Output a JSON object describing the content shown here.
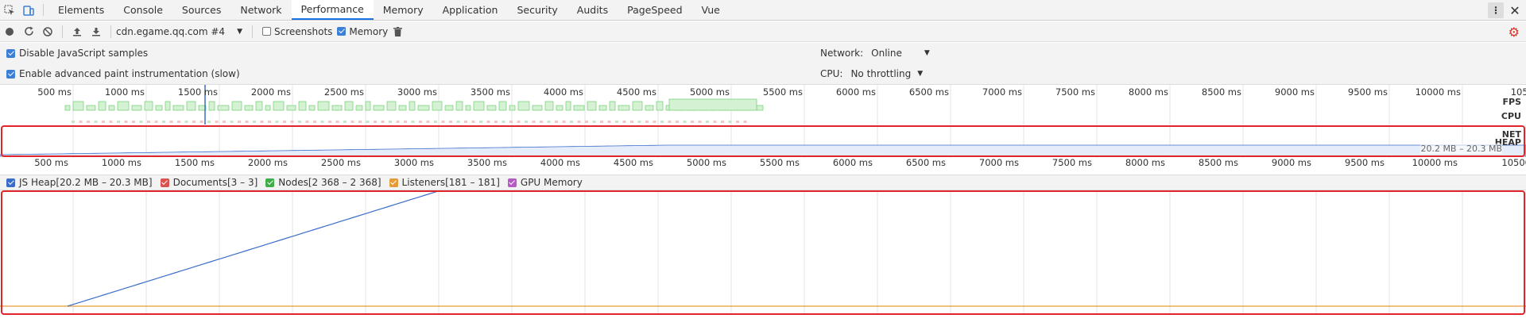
{
  "tabs": [
    "Elements",
    "Console",
    "Sources",
    "Network",
    "Performance",
    "Memory",
    "Application",
    "Security",
    "Audits",
    "PageSpeed",
    "Vue"
  ],
  "active_tab": "Performance",
  "toolbar": {
    "profile": "cdn.egame.qq.com #4",
    "screenshots_label": "Screenshots",
    "memory_label": "Memory"
  },
  "settings": {
    "disable_js_samples": "Disable JavaScript samples",
    "advanced_paint": "Enable advanced paint instrumentation (slow)",
    "network_label": "Network:",
    "network_value": "Online",
    "cpu_label": "CPU:",
    "cpu_value": "No throttling"
  },
  "overview": {
    "ticks": [
      "500 ms",
      "1000 ms",
      "1500 ms",
      "2000 ms",
      "2500 ms",
      "3000 ms",
      "3500 ms",
      "4000 ms",
      "4500 ms",
      "5000 ms",
      "5500 ms",
      "6000 ms",
      "6500 ms",
      "7000 ms",
      "7500 ms",
      "8000 ms",
      "8500 ms",
      "9000 ms",
      "9500 ms",
      "10000 ms",
      "1050"
    ],
    "labels": {
      "fps": "FPS",
      "cpu": "CPU",
      "net": "NET",
      "heap": "HEAP"
    },
    "heap_range": "20.2 MB – 20.3 MB"
  },
  "ruler2_ticks": [
    "500 ms",
    "1000 ms",
    "1500 ms",
    "2000 ms",
    "2500 ms",
    "3000 ms",
    "3500 ms",
    "4000 ms",
    "4500 ms",
    "5000 ms",
    "5500 ms",
    "6000 ms",
    "6500 ms",
    "7000 ms",
    "7500 ms",
    "8000 ms",
    "8500 ms",
    "9000 ms",
    "9500 ms",
    "10000 ms",
    "10500"
  ],
  "counters": [
    {
      "label": "JS Heap[20.2 MB – 20.3 MB]",
      "color": "#3b6cc9"
    },
    {
      "label": "Documents[3 – 3]",
      "color": "#d9534f"
    },
    {
      "label": "Nodes[2 368 – 2 368]",
      "color": "#3fae49"
    },
    {
      "label": "Listeners[181 – 181]",
      "color": "#e59b37"
    },
    {
      "label": "GPU Memory",
      "color": "#b75ac6"
    }
  ]
}
